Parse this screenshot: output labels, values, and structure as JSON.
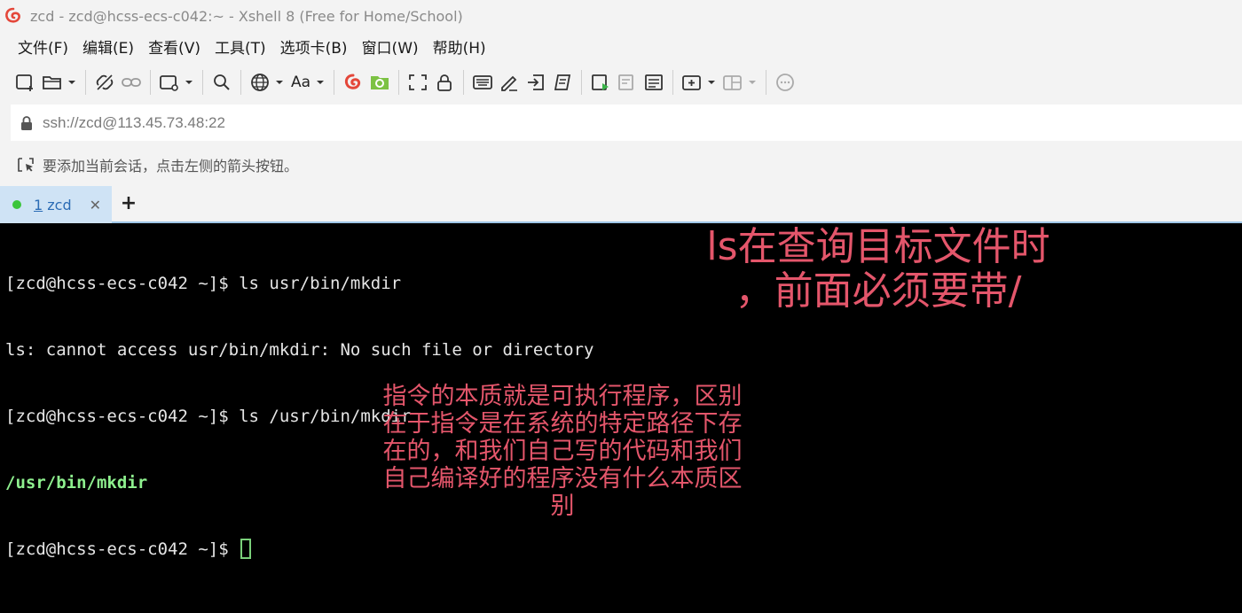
{
  "window": {
    "title": "zcd - zcd@hcss-ecs-c042:~ - Xshell 8 (Free for Home/School)",
    "logo_icon": "xshell-logo-icon"
  },
  "menu": {
    "items": [
      "文件(F)",
      "编辑(E)",
      "查看(V)",
      "工具(T)",
      "选项卡(B)",
      "窗口(W)",
      "帮助(H)"
    ]
  },
  "toolbar": {
    "icons": [
      "new-session-icon",
      "open-folder-icon",
      "disconnect-icon",
      "link-icon",
      "screen-settings-icon",
      "search-icon",
      "globe-icon",
      "font-icon",
      "xshell-icon",
      "xftp-icon",
      "fullscreen-icon",
      "lock-icon",
      "keyboard-icon",
      "pen-icon",
      "login-icon",
      "script-icon",
      "run-script-icon",
      "log-icon",
      "note-icon",
      "new-tab-icon",
      "layout-icon",
      "chat-icon"
    ],
    "font_label": "Aa"
  },
  "address": {
    "value": "ssh://zcd@113.45.73.48:22"
  },
  "hint": {
    "text": "要添加当前会话，点击左侧的箭头按钮。"
  },
  "tabs": [
    {
      "number": "1",
      "label": " zcd",
      "status_color": "#3bc53b",
      "close": "✕"
    }
  ],
  "tab_add": "+",
  "terminal": {
    "lines": [
      "[zcd@hcss-ecs-c042 ~]$ ls usr/bin/mkdir",
      "ls: cannot access usr/bin/mkdir: No such file or directory",
      "[zcd@hcss-ecs-c042 ~]$ ls /usr/bin/mkdir",
      "/usr/bin/mkdir",
      "[zcd@hcss-ecs-c042 ~]$ "
    ],
    "foreground": "#e5e5e5",
    "highlight_color": "#8ef08e",
    "background": "#000000"
  },
  "annotations": {
    "note1_line1": "ls在查询目标文件时",
    "note1_line2": "，前面必须要带/",
    "note2_lines": [
      "指令的本质就是可执行程序，区别",
      "在于指令是在系统的特定路径下存",
      "在的，和我们自己写的代码和我们",
      "自己编译好的程序没有什么本质区",
      "别"
    ],
    "color": "#e4566b"
  }
}
